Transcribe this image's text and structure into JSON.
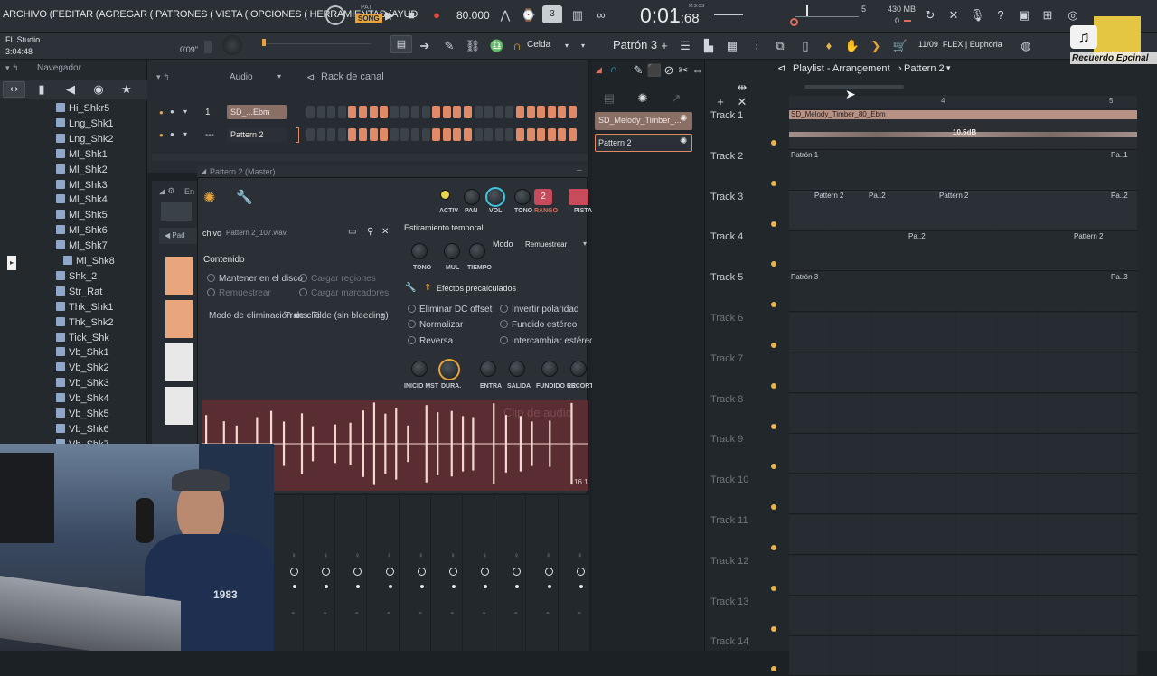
{
  "menubar": {
    "menu_text": "ARCHIVO (FEDITAR (AGREGAR ( PATRONES ( VISTA ( OPCIONES ( HERRAMIENTAS (AYUD",
    "song_badge": "SONG",
    "pat_label": "PAT",
    "tempo": "80.000",
    "time": "0:01",
    "time_frac": ":68",
    "time_unit": "M:S:CS",
    "memory": "430 MB",
    "cpu_count": "0",
    "mix_number": "5"
  },
  "toolbar2": {
    "app_name": "FL Studio",
    "app_time": "3:04:48",
    "position_readout": "0'09\"",
    "snap_label": "Celda",
    "pattern_selector": "Patrón 3",
    "news_text": "11/09  FLEX | Euphoria"
  },
  "browser": {
    "title": "Navegador",
    "items": [
      "Hi_Shkr5",
      "Lng_Shk1",
      "Lng_Shk2",
      "Ml_Shk1",
      "Ml_Shk2",
      "Ml_Shk3",
      "Ml_Shk4",
      "Ml_Shk5",
      "Ml_Shk6",
      "Ml_Shk7",
      "Ml_Shk8",
      "Shk_2",
      "Str_Rat",
      "Thk_Shk1",
      "Thk_Shk2",
      "Tick_Shk",
      "Vb_Shk1",
      "Vb_Shk2",
      "Vb_Shk3",
      "Vb_Shk4",
      "Vb_Shk5",
      "Vb_Shk6",
      "Vb_Shk7"
    ]
  },
  "channel_rack": {
    "filter": "Audio",
    "title": "Rack de canal",
    "channels": [
      {
        "number": "1",
        "name": "SD_...Ebm"
      },
      {
        "number": "---",
        "name": "Pattern 2"
      }
    ]
  },
  "sampler": {
    "title": "Pattern 2 (Master)",
    "partial_label": "En",
    "knob_labels": [
      "ACTIV",
      "PAN",
      "VOL",
      "TONO",
      "RANGO",
      "PISTA"
    ],
    "range_value": "2",
    "file_label": "chivo",
    "file_name": "Pattern 2_107.wav",
    "contenido": "Contenido",
    "keep_on_disk": "Mantener en el disco",
    "load_regions": "Cargar regiones",
    "resample": "Remuestrear",
    "load_markers": "Cargar marcadores",
    "declick_label": "Modo de eliminación de clic",
    "declick_value": "Trans. Tilde (sin bleeding)",
    "stretch_title": "Estiramiento temporal",
    "stretch_knobs": [
      "TONO",
      "MUL",
      "TIEMPO"
    ],
    "mode_label": "Modo",
    "mode_value": "Remuestrear",
    "precomputed": "Efectos precalculados",
    "effects": [
      "Eliminar DC offset",
      "Normalizar",
      "Reversa",
      "Invertir polaridad",
      "Fundido estéreo",
      "Intercambiar estéreo"
    ],
    "env_knobs": [
      "INICIO MST",
      "DURA.",
      "ENTRA",
      "SALIDA",
      "FUNDIDO CR",
      "RECORT"
    ],
    "clip_watermark": "Clip de audio",
    "wave_label": "16 1"
  },
  "picker": {
    "items": [
      "SD_Melody_Timber_...",
      "Pattern 2"
    ]
  },
  "playlist": {
    "title": "Playlist - Arrangement",
    "pattern": "Pattern 2",
    "ruler": [
      "4",
      "5"
    ],
    "tracks": [
      "Track 1",
      "Track 2",
      "Track 3",
      "Track 4",
      "Track 5",
      "Track 6",
      "Track 7",
      "Track 8",
      "Track 9",
      "Track 10",
      "Track 11",
      "Track 12",
      "Track 13",
      "Track 14"
    ],
    "clips": {
      "audio": "SD_Melody_Timber_80_Ebm",
      "gain": "10.5dB",
      "p1": "Patrón 1",
      "p1b": "Pa..1",
      "p2a": "Pattern 2",
      "p2b": "Pa..2",
      "p2c": "Pattern 2",
      "p2d": "Pa..2",
      "p2e": "Pa..2",
      "p2f": "Pattern 2",
      "p3": "Patrón 3",
      "p3b": "Pa..3"
    }
  },
  "logo": {
    "text": "Recuerdo Epcinal"
  },
  "colors": {
    "accent_orange": "#e08a68",
    "clip_audio": "#b79183",
    "track_dot": "#e6b44a",
    "vol_knob": "#3ec6e0"
  }
}
